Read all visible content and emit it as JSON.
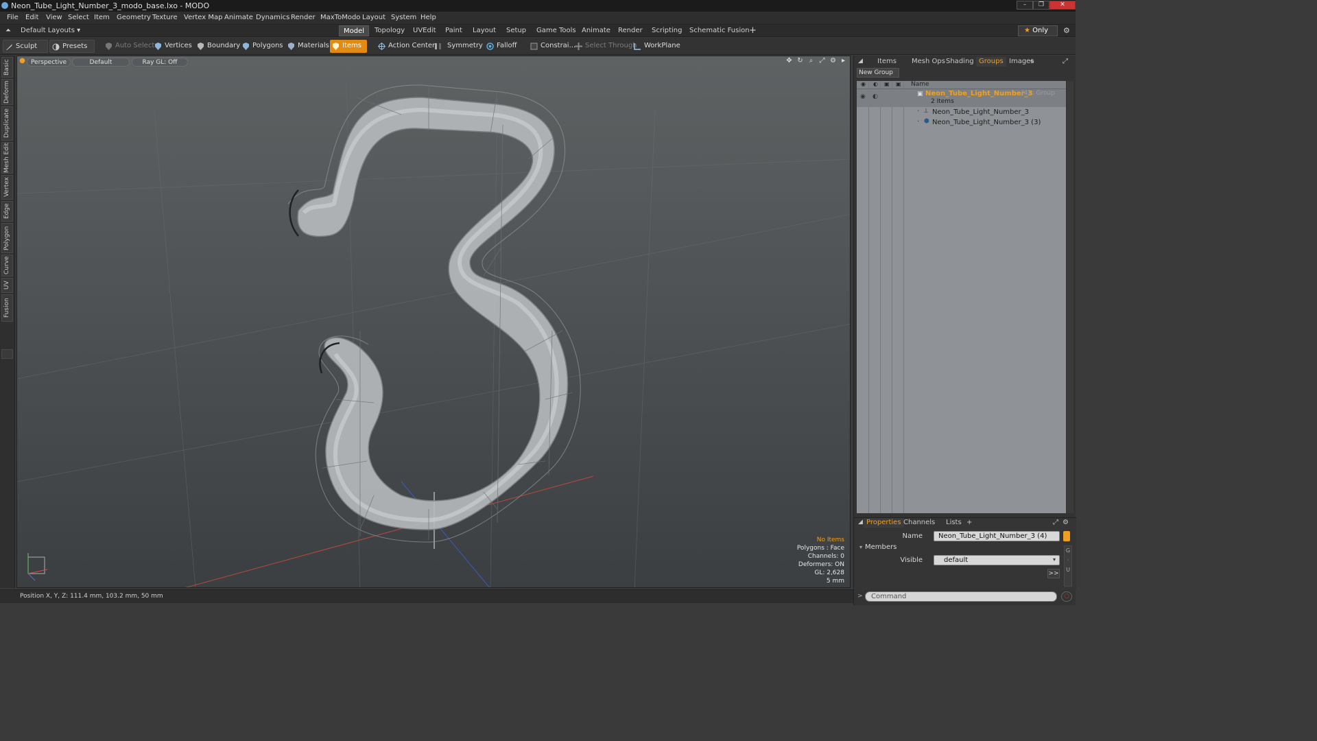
{
  "window": {
    "title": "Neon_Tube_Light_Number_3_modo_base.lxo - MODO",
    "minimize": "–",
    "restore": "❐",
    "close": "✕"
  },
  "menu": [
    "File",
    "Edit",
    "View",
    "Select",
    "Item",
    "Geometry",
    "Texture",
    "Vertex Map",
    "Animate",
    "Dynamics",
    "Render",
    "MaxToModo",
    "Layout",
    "System",
    "Help"
  ],
  "layout_bar": {
    "layouts_label": "Default Layouts ▾",
    "tabs": [
      "Model",
      "Topology",
      "UVEdit",
      "Paint",
      "Layout",
      "Setup",
      "Game Tools",
      "Animate",
      "Render",
      "Scripting",
      "Schematic Fusion"
    ],
    "active_tab": "Model",
    "add": "+",
    "only_label": "Only"
  },
  "toolbar": {
    "sculpt": "Sculpt",
    "presets": "Presets",
    "auto_select": "Auto Select",
    "vertices": "Vertices",
    "boundary": "Boundary",
    "polygons": "Polygons",
    "materials": "Materials",
    "items": "Items",
    "action_center": "Action Center",
    "symmetry": "Symmetry",
    "falloff": "Falloff",
    "constrain": "Constrai...",
    "select_through": "Select Through",
    "workplane": "WorkPlane"
  },
  "left_tabs": [
    "Basic",
    "Deform",
    "Duplicate",
    "Mesh Edit",
    "Vertex",
    "Edge",
    "Polygon",
    "Curve",
    "UV",
    "Fusion"
  ],
  "viewport": {
    "view": "Perspective",
    "shading": "Default",
    "raygl": "Ray GL: Off",
    "info": {
      "items": "No Items",
      "polygons": "Polygons : Face",
      "channels": "Channels: 0",
      "deformers": "Deformers: ON",
      "gl": "GL: 2,628",
      "scale": "5 mm"
    },
    "colors": {
      "wire": "#1e2224",
      "tube": "#a9acaf",
      "accent": "#f0a020"
    }
  },
  "status": {
    "position": "Position X, Y, Z:  111.4 mm, 103.2 mm, 50 mm"
  },
  "right_panel": {
    "tabs": [
      "Items",
      "Mesh Ops",
      "Shading",
      "Groups",
      "Images"
    ],
    "active_tab": "Groups",
    "add": "+",
    "new_group": "New Group",
    "col_name": "Name",
    "tree": {
      "group_name": "Neon_Tube_Light_Number_3",
      "group_suffix": "(4) : Group",
      "item_count": "2 Items",
      "children": [
        "Neon_Tube_Light_Number_3",
        "Neon_Tube_Light_Number_3 (3)"
      ]
    },
    "properties": {
      "tabs": [
        "Properties",
        "Channels",
        "Lists"
      ],
      "active_tab": "Properties",
      "add": "+",
      "name_label": "Name",
      "name_value": "Neon_Tube_Light_Number_3 (4)",
      "members": "Members",
      "visible_label": "Visible",
      "visible_value": "default",
      "more": ">>"
    },
    "command_placeholder": "Command"
  }
}
